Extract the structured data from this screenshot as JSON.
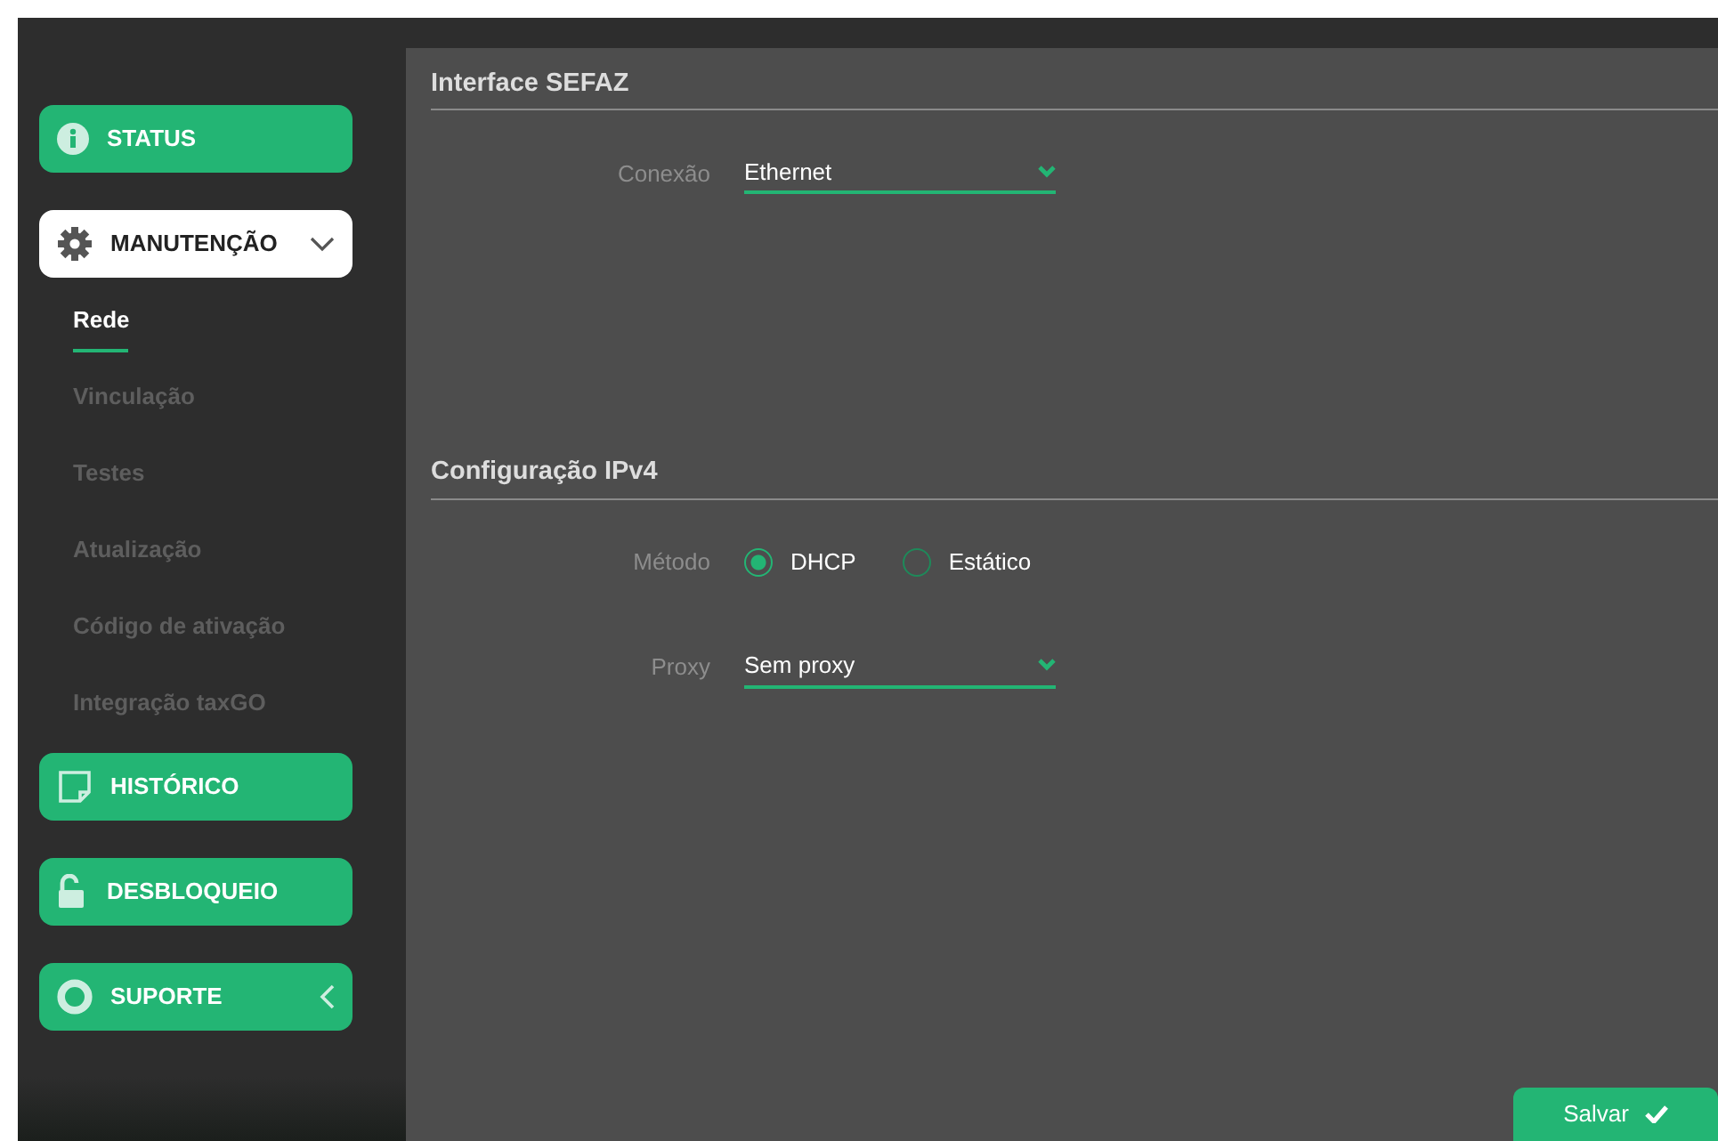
{
  "sidebar": {
    "items": [
      {
        "label": "STATUS",
        "kind": "link",
        "selected": false
      },
      {
        "label": "MANUTENÇÃO",
        "kind": "menu",
        "expanded": true,
        "selected": true,
        "children": [
          {
            "label": "Rede",
            "selected": true
          },
          {
            "label": "Vinculação",
            "selected": false
          },
          {
            "label": "Testes",
            "selected": false
          },
          {
            "label": "Atualização",
            "selected": false
          },
          {
            "label": "Código de ativação",
            "selected": false
          },
          {
            "label": "Integração taxGO",
            "selected": false
          }
        ]
      },
      {
        "label": "HISTÓRICO",
        "kind": "link",
        "selected": false
      },
      {
        "label": "DESBLOQUEIO",
        "kind": "link",
        "selected": false
      },
      {
        "label": "SUPORTE",
        "kind": "menu",
        "expanded": false,
        "selected": false
      }
    ]
  },
  "sections": [
    {
      "title": "Interface SEFAZ",
      "fields": [
        {
          "kind": "select",
          "label": "Conexão",
          "value": "Ethernet"
        }
      ]
    },
    {
      "title": "Configuração IPv4",
      "fields": [
        {
          "kind": "radio",
          "label": "Método",
          "options": [
            {
              "label": "DHCP",
              "selected": true
            },
            {
              "label": "Estático",
              "selected": false
            }
          ]
        },
        {
          "kind": "select",
          "label": "Proxy",
          "value": "Sem proxy"
        }
      ]
    }
  ],
  "save_button": {
    "label": "Salvar"
  }
}
